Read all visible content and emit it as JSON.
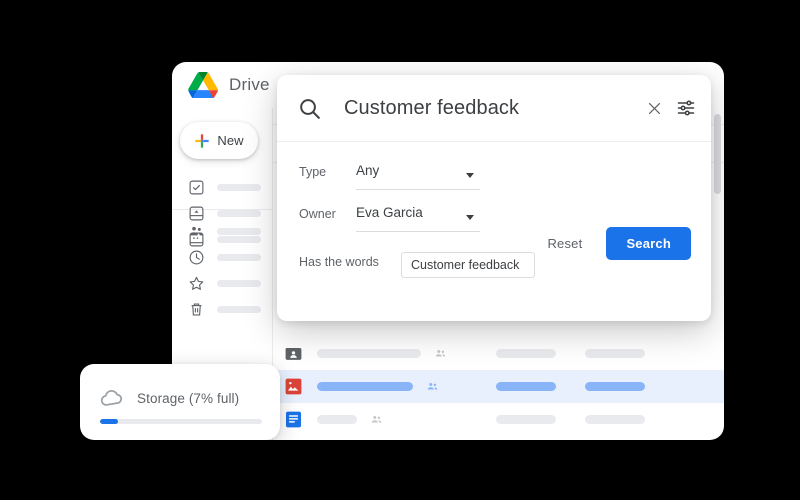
{
  "app": {
    "name": "Drive",
    "logo_icon": "google-drive-logo"
  },
  "sidebar": {
    "new_button": {
      "label": "New",
      "icon": "plus-icon"
    },
    "groups": [
      {
        "items": [
          {
            "icon": "check-circle-icon"
          },
          {
            "icon": "priority-box-icon"
          },
          {
            "icon": "id-card-icon"
          }
        ]
      },
      {
        "items": [
          {
            "icon": "people-shared-icon"
          },
          {
            "icon": "clock-recent-icon"
          },
          {
            "icon": "star-outline-icon"
          },
          {
            "icon": "trash-icon"
          }
        ]
      }
    ]
  },
  "search_dialog": {
    "header": {
      "search_icon": "search-icon",
      "query": "Customer feedback",
      "close_icon": "close-icon",
      "tune_icon": "tune-filter-icon"
    },
    "fields": [
      {
        "label": "Type",
        "control": "select",
        "value": "Any",
        "caret_icon": "chevron-down-icon"
      },
      {
        "label": "Owner",
        "control": "select",
        "value": "Eva Garcia",
        "caret_icon": "chevron-down-icon"
      },
      {
        "label": "Has the words",
        "control": "text",
        "value": "Customer feedback",
        "placeholder": ""
      }
    ],
    "actions": {
      "reset_label": "Reset",
      "search_label": "Search",
      "search_accent_color": "#1a73e8"
    }
  },
  "file_list": {
    "rows": [
      {
        "icon": "shared-folder-icon",
        "icon_color": "#5f6368",
        "selected": false,
        "name_bar_width": 104,
        "shared_icon": "people-icon",
        "col2_width": 60,
        "col3_width": 60
      },
      {
        "icon": "image-file-icon",
        "icon_color": "#db4437",
        "selected": true,
        "name_bar_width": 96,
        "shared_icon": "people-icon",
        "col2_width": 60,
        "col3_width": 60
      },
      {
        "icon": "google-docs-icon",
        "icon_color": "#1a73e8",
        "selected": false,
        "name_bar_width": 40,
        "shared_icon": "people-icon",
        "col2_width": 60,
        "col3_width": 60
      }
    ],
    "selected_row_color": "#e8f0fe"
  },
  "storage_card": {
    "icon": "cloud-icon",
    "label": "Storage (7% full)",
    "percent_full": 7,
    "bar_fill_percent": 11,
    "fill_color": "#1a73e8"
  },
  "scrollbar": {
    "thumb_icon": "scrollbar-thumb"
  }
}
